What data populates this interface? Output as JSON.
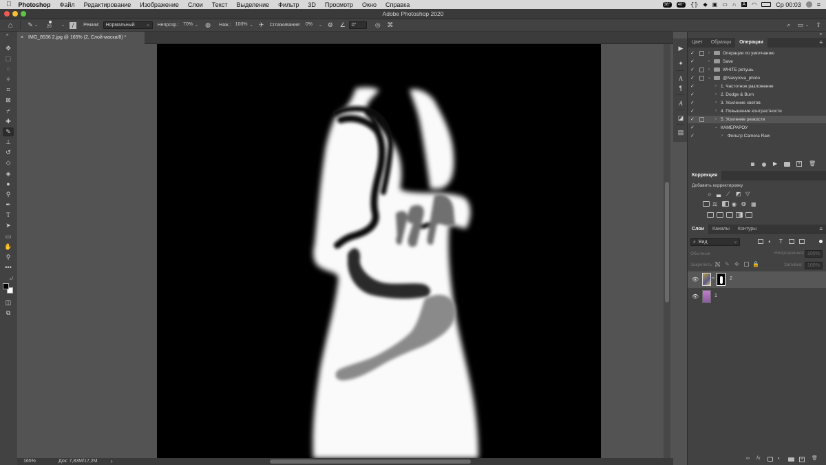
{
  "menubar": {
    "apple_icon": "apple-logo",
    "app_name": "Photoshop",
    "items": [
      "Файл",
      "Редактирование",
      "Изображение",
      "Слои",
      "Текст",
      "Выделение",
      "Фильтр",
      "3D",
      "Просмотр",
      "Окно",
      "Справка"
    ],
    "temp1": "36°",
    "temp2": "40°",
    "clock": "Ср 00:03"
  },
  "titlebar": {
    "title": "Adobe Photoshop 2020"
  },
  "options": {
    "brush_size": "20",
    "mode_label": "Режим:",
    "mode_value": "Нормальный",
    "opacity_label": "Непрозр.:",
    "opacity_value": "70%",
    "flow_label": "Наж.:",
    "flow_value": "100%",
    "smoothing_label": "Сглаживание:",
    "smoothing_value": "0%",
    "angle_value": "0°"
  },
  "document": {
    "tab_title": "IMG_8536 2.jpg @ 165% (2, Слой-маска/8) *",
    "close_icon": "×"
  },
  "status": {
    "zoom": "165%",
    "doc_info": "Док: 7,83M/17,2M",
    "arrow": "›"
  },
  "actions_panel": {
    "tabs": [
      "Цвет",
      "Образцы",
      "Операции"
    ],
    "active_tab": "Операции",
    "rows": [
      {
        "label": "Операции по умолчанию",
        "level": 0,
        "folder": true
      },
      {
        "label": "Save",
        "level": 0,
        "folder": true
      },
      {
        "label": "WHITE  ретушь",
        "level": 0,
        "folder": true
      },
      {
        "label": "@Nasyrova_photo",
        "level": 0,
        "folder": true,
        "expanded": true
      },
      {
        "label": "1. Частотное разложение",
        "level": 1
      },
      {
        "label": "2. Dodge & Burn",
        "level": 1
      },
      {
        "label": "3. Усиление светов",
        "level": 1
      },
      {
        "label": "4. Повышение контрастности",
        "level": 1
      },
      {
        "label": "5. Усиление резкости",
        "level": 1,
        "selected": true
      },
      {
        "label": "КАМЕРАРОУ",
        "level": 1,
        "expanded": true
      },
      {
        "label": "Фильтр Camera Raw",
        "level": 2
      }
    ]
  },
  "adjustments_panel": {
    "tab": "Коррекция",
    "subtitle": "Добавить корректировку"
  },
  "layers_panel": {
    "tabs": [
      "Слои",
      "Каналы",
      "Контуры"
    ],
    "active_tab": "Слои",
    "filter_value": "Вид",
    "blend_mode": "Обычные",
    "opacity_label": "Непрозрачность:",
    "opacity_value": "100%",
    "lock_label": "Закрепить:",
    "fill_label": "Заливка:",
    "fill_value": "100%",
    "layers": [
      {
        "name": "2",
        "selected": true,
        "has_mask": true
      },
      {
        "name": "1",
        "selected": false,
        "has_mask": false
      }
    ]
  }
}
